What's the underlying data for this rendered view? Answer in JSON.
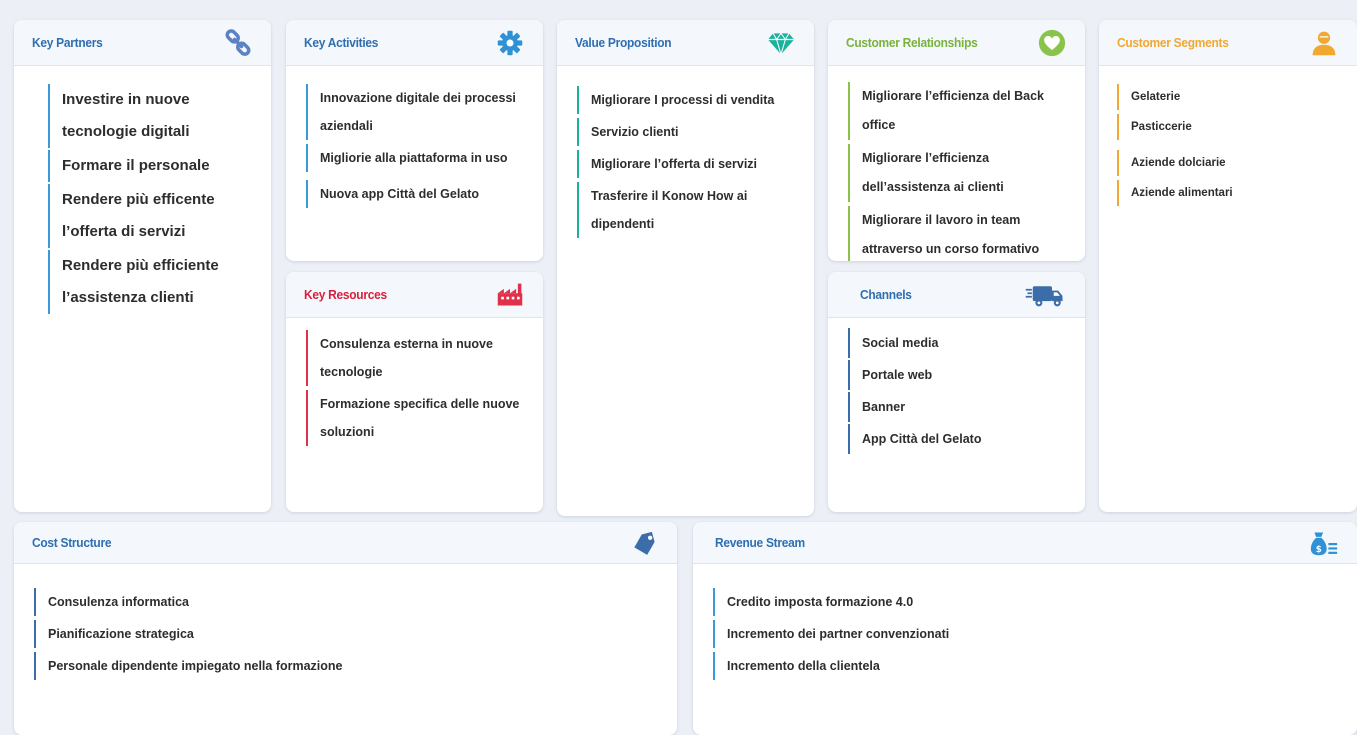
{
  "colors": {
    "background": "#ecf0f6",
    "key_partners": "#3a9ad9",
    "key_activities": "#3a9ad9",
    "key_resources": "#e0314b",
    "value_proposition": "#1bb29b",
    "customer_relationships": "#8ac34a",
    "channels": "#3b6ea8",
    "customer_segments": "#f0a830",
    "cost_structure": "#3b6ea8",
    "revenue_stream": "#3a9ad9"
  },
  "key_partners": {
    "title": "Key Partners",
    "icon": "link-icon",
    "items": [
      "Investire in nuove tecnologie digitali",
      "Formare il personale",
      "Rendere più efficente l’offerta di servizi",
      "Rendere più efficiente l’assistenza clienti"
    ]
  },
  "key_activities": {
    "title": "Key Activities",
    "icon": "gear-icon",
    "items": [
      "Innovazione digitale dei processi aziendali",
      "Migliorie alla piattaforma in uso",
      "Nuova app Città del Gelato"
    ]
  },
  "key_resources": {
    "title": "Key Resources",
    "icon": "factory-icon",
    "items": [
      "Consulenza esterna in nuove tecnologie",
      "Formazione specifica delle nuove soluzioni"
    ]
  },
  "value_proposition": {
    "title": "Value Proposition",
    "icon": "diamond-icon",
    "items": [
      "Migliorare I processi di vendita",
      "Servizio clienti",
      "Migliorare l’offerta di servizi",
      "Trasferire il Konow How ai dipendenti"
    ]
  },
  "customer_relationships": {
    "title": "Customer Relationships",
    "icon": "heart-icon",
    "items": [
      "Migliorare l’efficienza del Back office",
      "Migliorare l’efficienza dell’assistenza ai clienti",
      "Migliorare il lavoro in team attraverso un corso formativo"
    ]
  },
  "channels": {
    "title": "Channels",
    "icon": "truck-icon",
    "items": [
      "Social media",
      "Portale web",
      "Banner",
      "App Città del Gelato"
    ]
  },
  "customer_segments": {
    "title": "Customer Segments",
    "icon": "user-icon",
    "items": [
      "Gelaterie",
      "Pasticcerie",
      "Aziende dolciarie",
      "Aziende alimentari"
    ]
  },
  "cost_structure": {
    "title": "Cost Structure",
    "icon": "tag-icon",
    "items": [
      "Consulenza informatica",
      "Pianificazione strategica",
      "Personale dipendente impiegato nella formazione"
    ]
  },
  "revenue_stream": {
    "title": "Revenue Stream",
    "icon": "money-bag-icon",
    "items": [
      "Credito imposta formazione 4.0",
      "Incremento dei partner convenzionati",
      "Incremento della clientela"
    ]
  }
}
